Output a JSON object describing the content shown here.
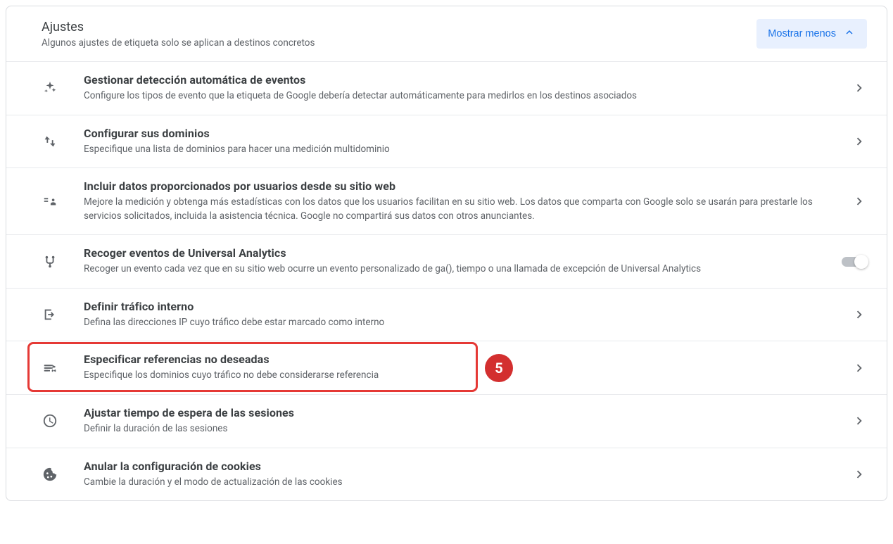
{
  "header": {
    "title": "Ajustes",
    "subtitle": "Algunos ajustes de etiqueta solo se aplican a destinos concretos",
    "toggle_label": "Mostrar menos"
  },
  "rows": [
    {
      "icon": "sparkle-icon",
      "title": "Gestionar detección automática de eventos",
      "desc": "Configure los tipos de evento que la etiqueta de Google debería detectar automáticamente para medirlos en los destinos asociados",
      "action": "chevron"
    },
    {
      "icon": "arrows-swap-icon",
      "title": "Configurar sus dominios",
      "desc": "Especifique una lista de dominios para hacer una medición multidominio",
      "action": "chevron"
    },
    {
      "icon": "user-tag-icon",
      "title": "Incluir datos proporcionados por usuarios desde su sitio web",
      "desc": "Mejore la medición y obtenga más estadísticas con los datos que los usuarios facilitan en su sitio web. Los datos que comparta con Google solo se usarán para prestarle los servicios solicitados, incluida la asistencia técnica. Google no compartirá sus datos con otros anunciantes.",
      "action": "chevron"
    },
    {
      "icon": "fork-icon",
      "title": "Recoger eventos de Universal Analytics",
      "desc": "Recoger un evento cada vez que en su sitio web ocurre un evento personalizado de ga(), tiempo o una llamada de excepción de Universal Analytics",
      "action": "toggle"
    },
    {
      "icon": "exit-icon",
      "title": "Definir tráfico interno",
      "desc": "Defina las direcciones IP cuyo tráfico debe estar marcado como interno",
      "action": "chevron"
    },
    {
      "icon": "filter-list-icon",
      "title": "Especificar referencias no deseadas",
      "desc": "Especifique los dominios cuyo tráfico no debe considerarse referencia",
      "action": "chevron",
      "highlight": true,
      "annotation": "5"
    },
    {
      "icon": "clock-icon",
      "title": "Ajustar tiempo de espera de las sesiones",
      "desc": "Definir la duración de las sesiones",
      "action": "chevron"
    },
    {
      "icon": "cookie-icon",
      "title": "Anular la configuración de cookies",
      "desc": "Cambie la duración y el modo de actualización de las cookies",
      "action": "chevron"
    }
  ]
}
